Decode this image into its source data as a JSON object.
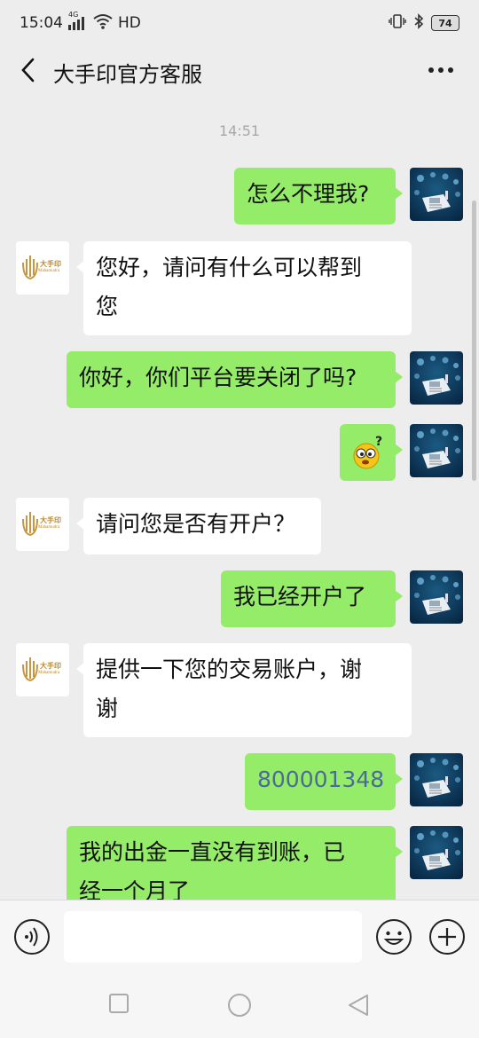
{
  "status_bar": {
    "time": "15:04",
    "network": "4G",
    "hd": "HD",
    "battery": "74"
  },
  "header": {
    "title": "大手印官方客服"
  },
  "chat": {
    "timestamp": "14:51",
    "service_logo_text": "大手印",
    "service_logo_subtext": "Mahamudra",
    "messages": [
      {
        "side": "mine",
        "text": "怎么不理我?"
      },
      {
        "side": "theirs",
        "line1": "您好，请问有什么可以帮到",
        "line2": "您"
      },
      {
        "side": "mine",
        "text": "你好，你们平台要关闭了吗?"
      },
      {
        "side": "mine",
        "type": "emoji",
        "icon": "confused-emoji"
      },
      {
        "side": "theirs",
        "text": "请问您是否有开户？"
      },
      {
        "side": "mine",
        "text": "我已经开户了"
      },
      {
        "side": "theirs",
        "line1": "提供一下您的交易账户，谢",
        "line2": "谢"
      },
      {
        "side": "mine",
        "text": "800001348"
      },
      {
        "side": "mine",
        "line1": "我的出金一直没有到账，已",
        "line2": "经一个月了"
      }
    ]
  },
  "input": {
    "placeholder": ""
  },
  "colors": {
    "background": "#ededed",
    "my_bubble": "#95ec69",
    "their_bubble": "#ffffff",
    "link": "#4a6b98"
  }
}
